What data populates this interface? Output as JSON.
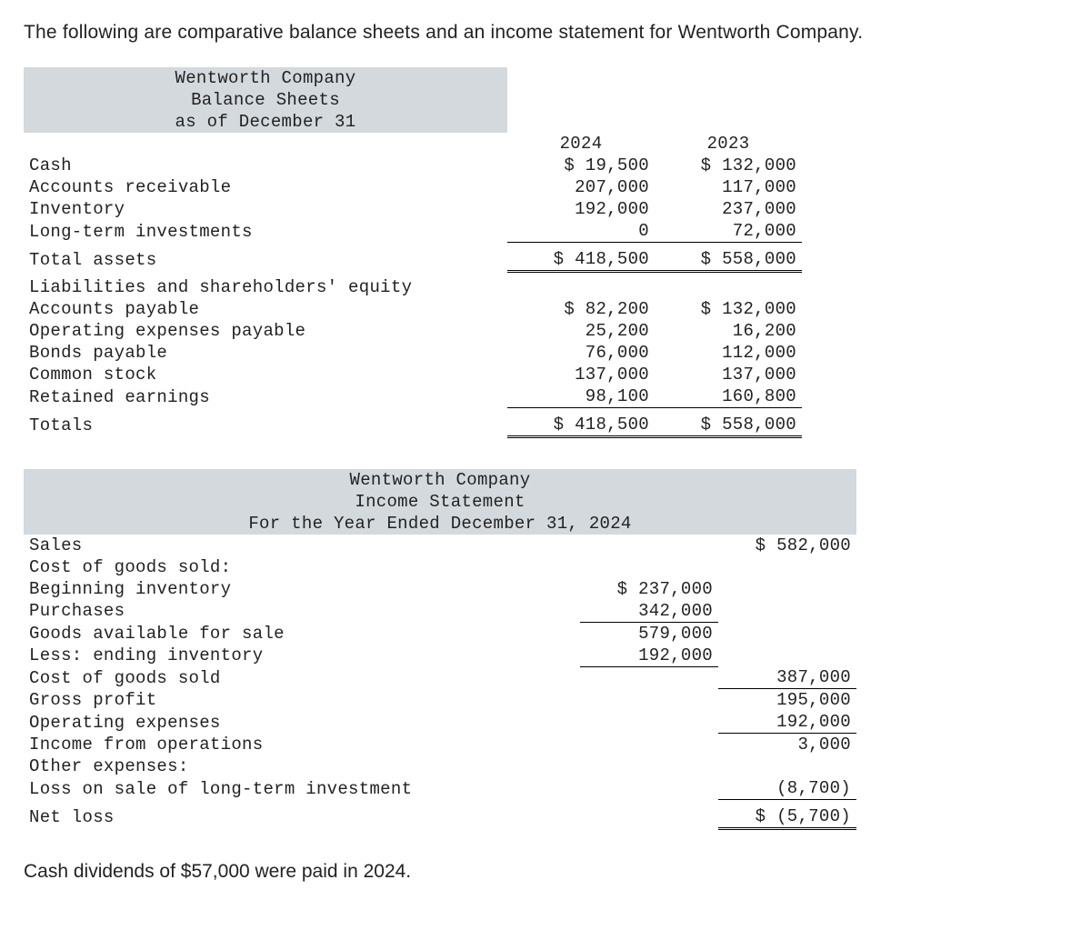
{
  "intro": "The following are comparative balance sheets and an income statement for Wentworth Company.",
  "bs": {
    "title1": "Wentworth Company",
    "title2": "Balance Sheets",
    "title3": "as of December 31",
    "year1": "2024",
    "year2": "2023",
    "rows": {
      "cash": {
        "label": "Cash",
        "v1": "$ 19,500",
        "v2": "$ 132,000"
      },
      "ar": {
        "label": "Accounts receivable",
        "v1": "207,000",
        "v2": "117,000"
      },
      "inv": {
        "label": "Inventory",
        "v1": "192,000",
        "v2": "237,000"
      },
      "lti": {
        "label": "Long-term investments",
        "v1": "0",
        "v2": "72,000"
      },
      "ta": {
        "label": "Total assets",
        "v1": "$ 418,500",
        "v2": "$ 558,000"
      },
      "lse": {
        "label": "Liabilities and shareholders' equity"
      },
      "ap": {
        "label": "Accounts payable",
        "v1": "$ 82,200",
        "v2": "$ 132,000"
      },
      "oep": {
        "label": "Operating expenses payable",
        "v1": "25,200",
        "v2": "16,200"
      },
      "bp": {
        "label": "Bonds payable",
        "v1": "76,000",
        "v2": "112,000"
      },
      "cs": {
        "label": "Common stock",
        "v1": "137,000",
        "v2": "137,000"
      },
      "re": {
        "label": "Retained earnings",
        "v1": "98,100",
        "v2": "160,800"
      },
      "tot": {
        "label": "Totals",
        "v1": "$ 418,500",
        "v2": "$ 558,000"
      }
    }
  },
  "is": {
    "title1": "Wentworth Company",
    "title2": "Income Statement",
    "title3": "For the Year Ended December 31, 2024",
    "rows": {
      "sales": {
        "label": "Sales",
        "v2": "$ 582,000"
      },
      "cogsh": {
        "label": "Cost of goods sold:"
      },
      "beginv": {
        "label": "Beginning inventory",
        "v1": "$ 237,000"
      },
      "purch": {
        "label": "Purchases",
        "v1": "342,000"
      },
      "gafs": {
        "label": "Goods available for sale",
        "v1": "579,000"
      },
      "endinv": {
        "label": "Less: ending inventory",
        "v1": "192,000"
      },
      "cogs": {
        "label": "Cost of goods sold",
        "v2": "387,000"
      },
      "gp": {
        "label": "Gross profit",
        "v2": "195,000"
      },
      "opex": {
        "label": "Operating expenses",
        "v2": "192,000"
      },
      "ifo": {
        "label": "Income from operations",
        "v2": "3,000"
      },
      "oeh": {
        "label": "Other expenses:"
      },
      "loss": {
        "label": "Loss on sale of long-term investment",
        "v2": "(8,700)"
      },
      "nl": {
        "label": "Net loss",
        "v2": "$ (5,700)"
      }
    }
  },
  "footnote": "Cash dividends of $57,000 were paid in 2024."
}
